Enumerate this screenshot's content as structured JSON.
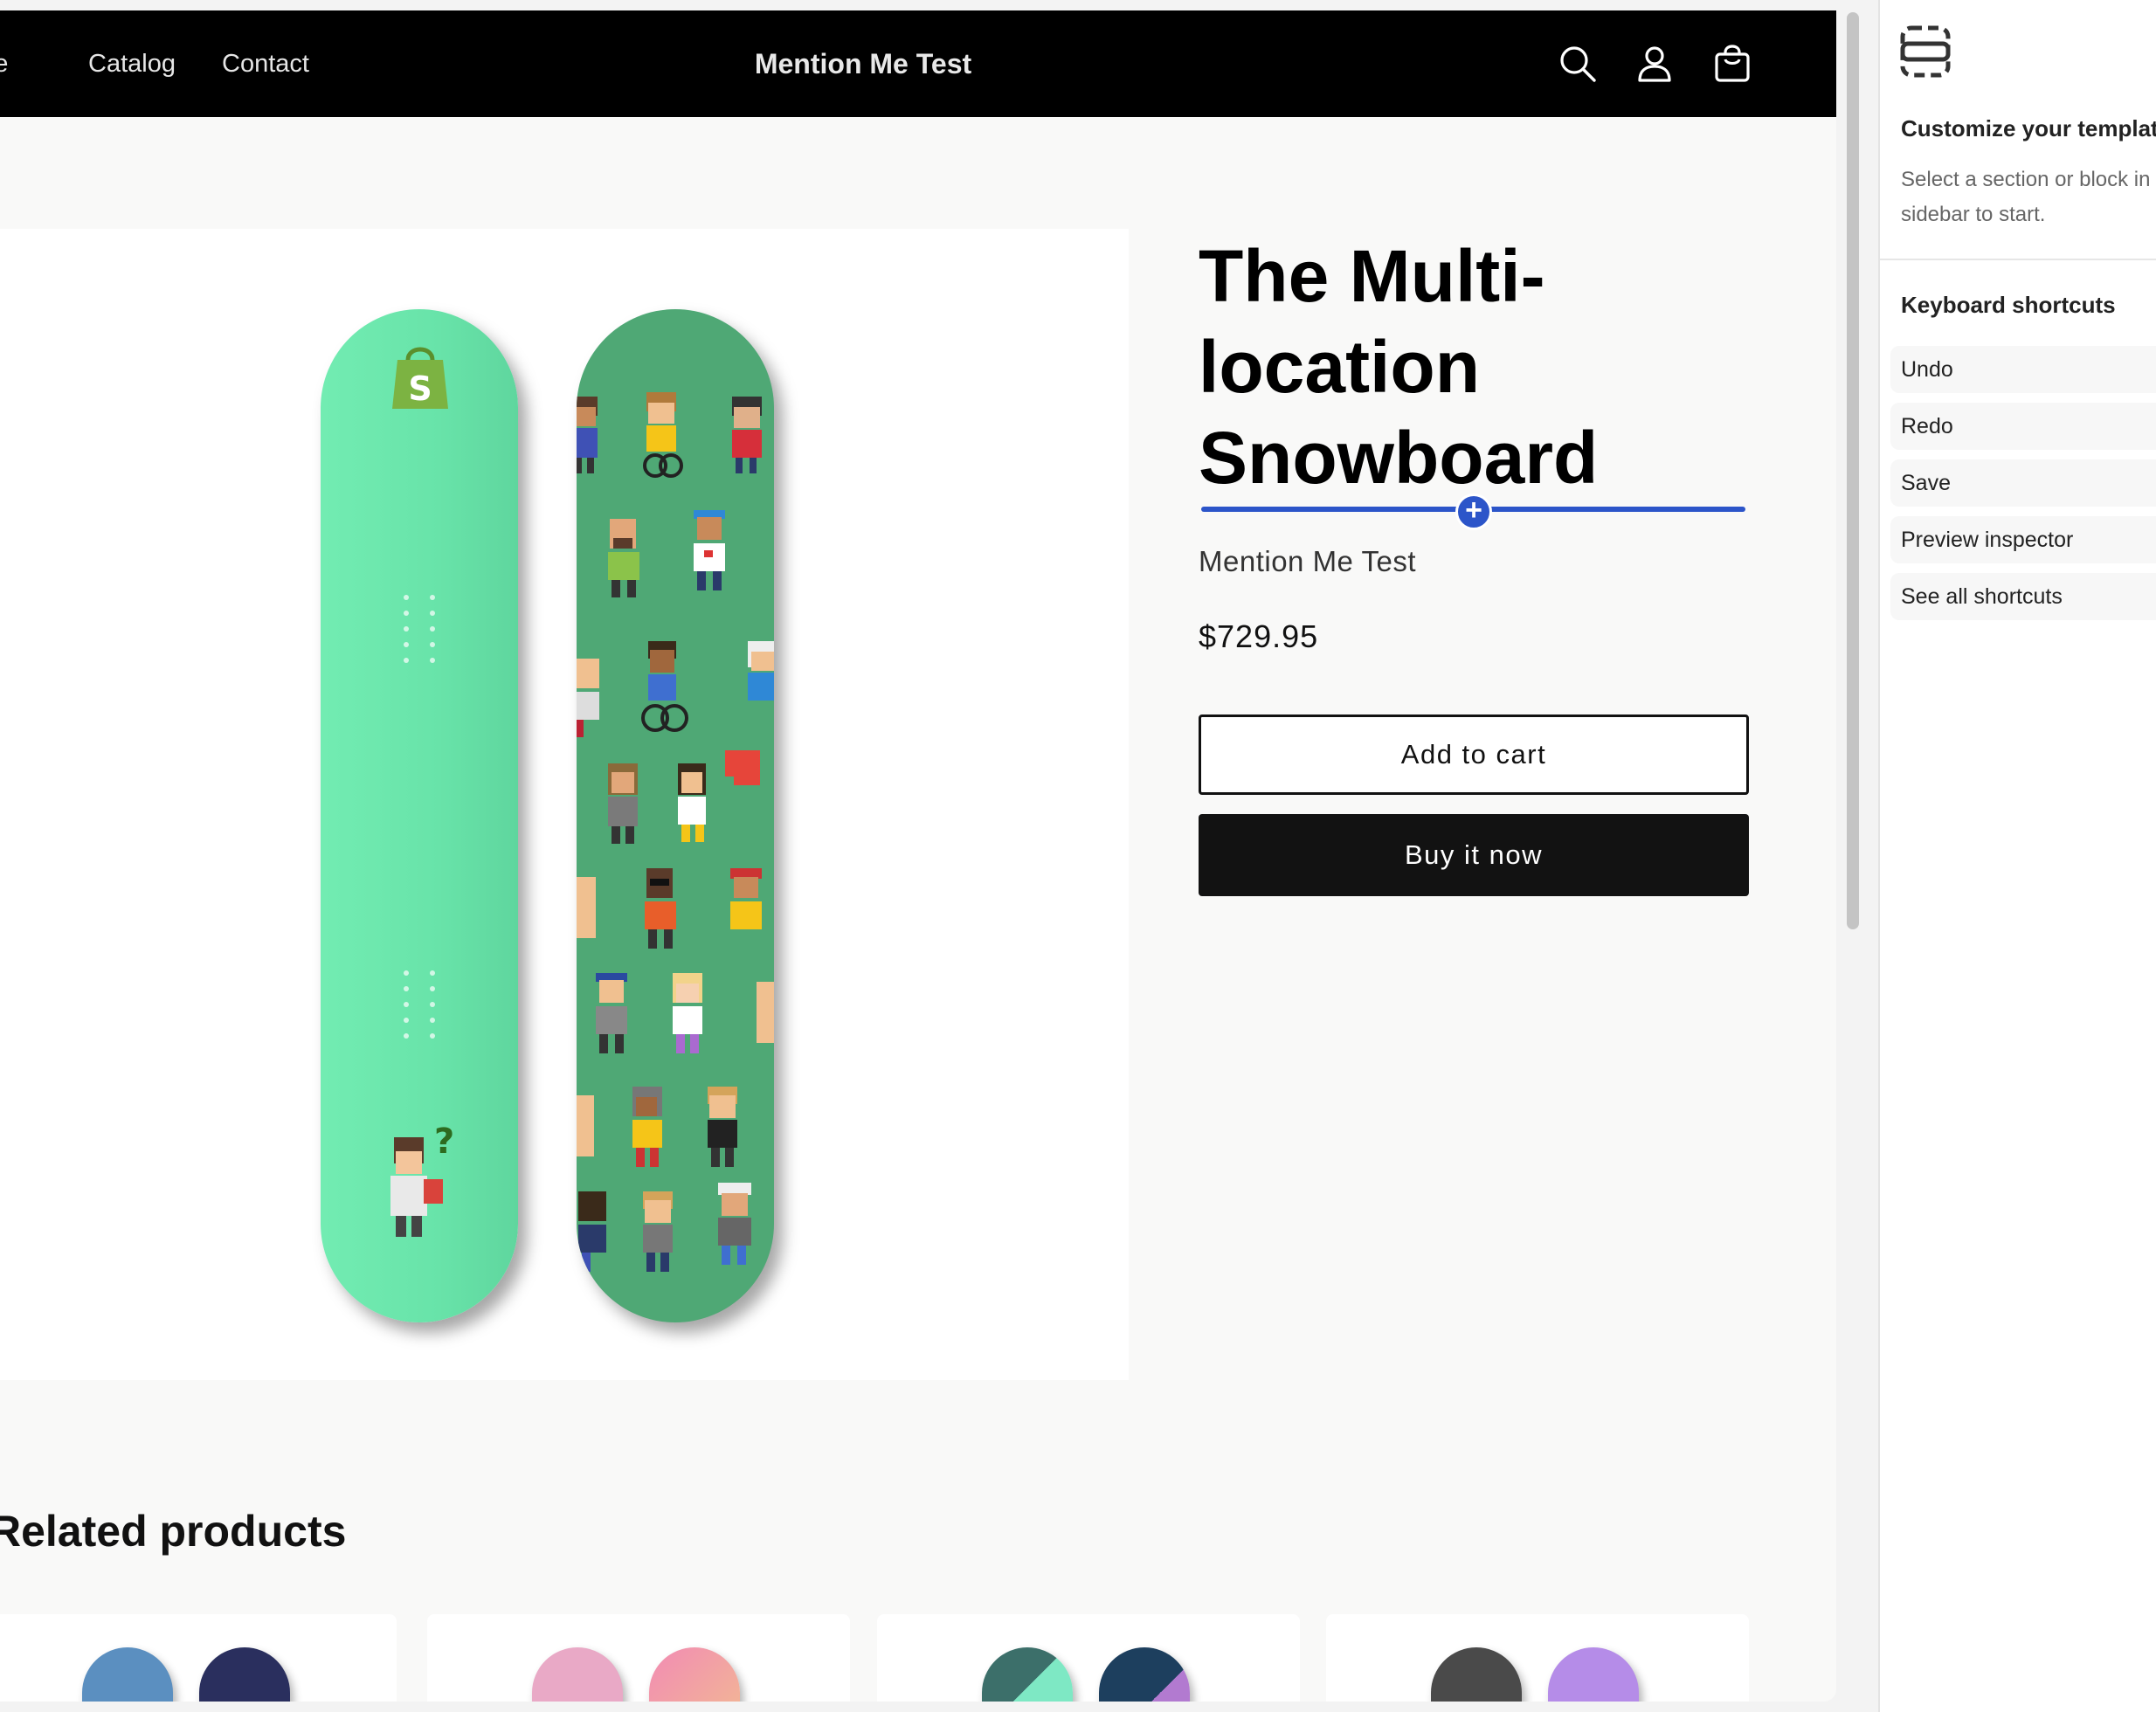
{
  "header": {
    "nav": [
      "Home",
      "Catalog",
      "Contact"
    ],
    "store_name": "Mention Me Test",
    "icons": [
      "search-icon",
      "account-icon",
      "cart-icon"
    ]
  },
  "product": {
    "title": "The Multi-location Snowboard",
    "vendor": "Mention Me Test",
    "price": "$729.95",
    "add_to_cart_label": "Add to cart",
    "buy_now_label": "Buy it now"
  },
  "related": {
    "heading": "Related products"
  },
  "sidebar": {
    "heading": "Customize your template",
    "hint": "Select a section or block in the sidebar to start.",
    "shortcuts_heading": "Keyboard shortcuts",
    "shortcuts": [
      "Undo",
      "Redo",
      "Save",
      "Preview inspector",
      "See all shortcuts"
    ]
  },
  "colors": {
    "header_bg": "#000000",
    "accent": "#2c55c9",
    "board_light": "#6fe8ae",
    "board_dark": "#4fa875"
  }
}
